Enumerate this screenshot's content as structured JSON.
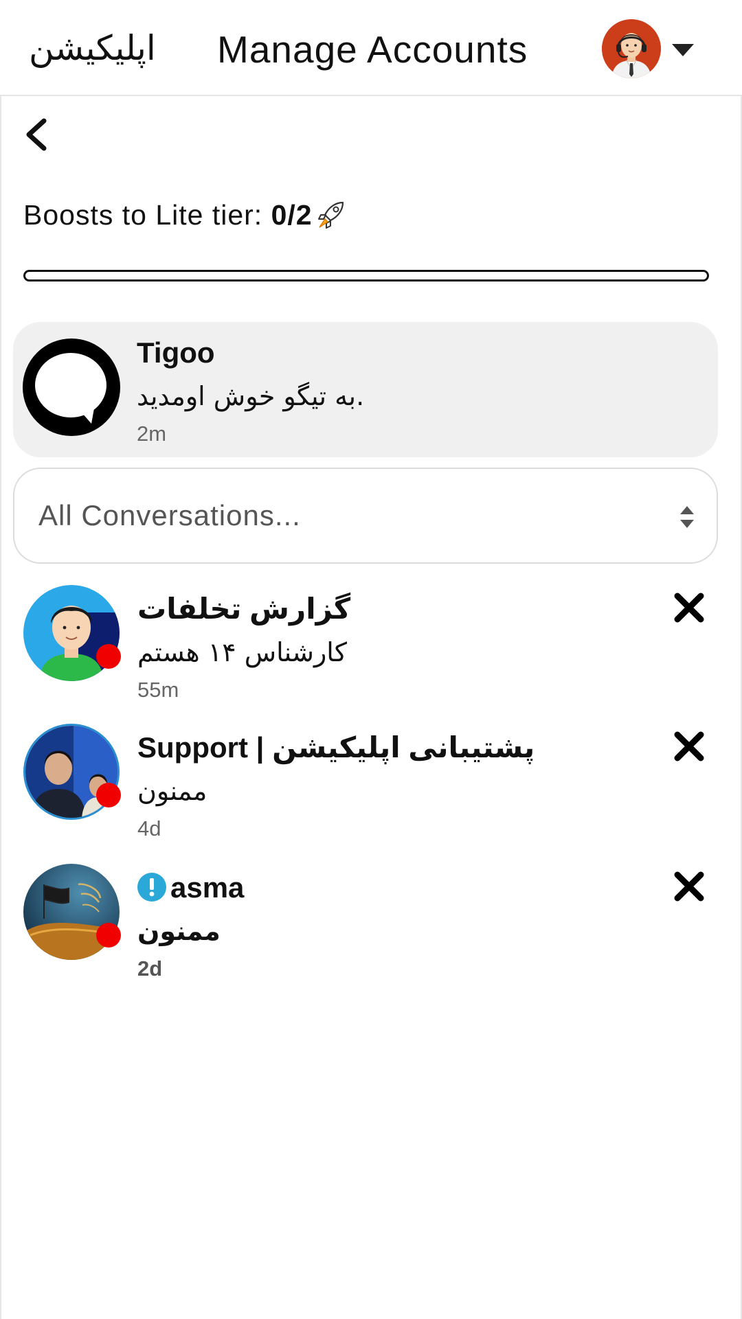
{
  "header": {
    "brand": "اپلیکیشن",
    "title": "Manage Accounts"
  },
  "boosts": {
    "label": "Boosts to Lite tier: ",
    "count": "0/2",
    "progress_fraction": 0
  },
  "pinned": {
    "name": "Tigoo",
    "message": "به تیگو خوش اومدید.",
    "time": "2m"
  },
  "filter": {
    "selected": "All Conversations..."
  },
  "conversations": [
    {
      "name": "گزارش تخلفات",
      "message": "کارشناس ۱۴ هستم",
      "time": "55m",
      "unread": true
    },
    {
      "name": "Support | پشتیبانی اپلیکیشن",
      "message": "ممنون",
      "time": "4d",
      "unread": true
    },
    {
      "name": "asma",
      "message": "ممنون",
      "time": "2d",
      "unread": true,
      "warning": true
    }
  ],
  "colors": {
    "status_dot": "#f00000",
    "card_bg": "#f0f0f0",
    "warning": "#2aa8d8",
    "avatar_bg": "#cc3d1a"
  }
}
